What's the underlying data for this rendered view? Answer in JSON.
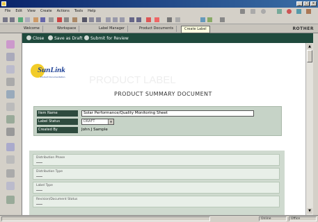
{
  "window": {
    "title": "",
    "buttons": [
      "_",
      "□",
      "×"
    ]
  },
  "menubar": {
    "items": [
      "File",
      "Edit",
      "View",
      "Create",
      "Actions",
      "Tools",
      "Help"
    ]
  },
  "toolbar": {
    "icons": [
      "back-icon",
      "forward-icon",
      "stop-icon",
      "refresh-icon",
      "home-icon",
      "search-icon",
      "print-icon",
      "cut-icon",
      "copy-icon",
      "paste-icon",
      "bold-icon",
      "italic-icon",
      "underline-icon",
      "align-left-icon",
      "align-center-icon",
      "align-right-icon",
      "bullet-list-icon",
      "indent-icon",
      "link-icon",
      "image-icon",
      "table-icon",
      "attach-icon"
    ]
  },
  "tabs": [
    {
      "label": "Welcome",
      "active": false
    },
    {
      "label": "Workspace",
      "active": false
    },
    {
      "label": "Label Manager",
      "active": false
    },
    {
      "label": "Product Documents",
      "active": false
    },
    {
      "label": "Create Label",
      "active": true
    }
  ],
  "brand": "ROTHER",
  "action_bar": {
    "close_label": "Close",
    "save_label": "Save as Draft",
    "submit_label": "Submit for Review"
  },
  "logo": {
    "wordmark": "SunLink",
    "tagline": "Product Documentation"
  },
  "document": {
    "heading": "PRODUCT LABEL",
    "title": "PRODUCT SUMMARY DOCUMENT"
  },
  "form": {
    "rows": [
      {
        "label": "Item Name",
        "value": "Solar Performance/Quality Monitoring Sheet"
      },
      {
        "label": "Label Status",
        "value": "DRAFT"
      },
      {
        "label": "Created By",
        "value": "John J Sample"
      }
    ]
  },
  "sections": [
    {
      "title": "Distribution Phase"
    },
    {
      "title": "Distribution Type"
    },
    {
      "title": "Label Type"
    },
    {
      "title": "Revision/Document Status"
    }
  ],
  "statusbar": {
    "left": "",
    "right_1": "Online",
    "right_2": "Office"
  },
  "colors": {
    "title_bar": "#0a246a",
    "action_bar": "#1f4a3d",
    "form_panel": "#c6d3c7",
    "label_cell": "#2e4b3e",
    "logo_blue": "#1c3f95",
    "logo_sun": "#f2cc29"
  }
}
